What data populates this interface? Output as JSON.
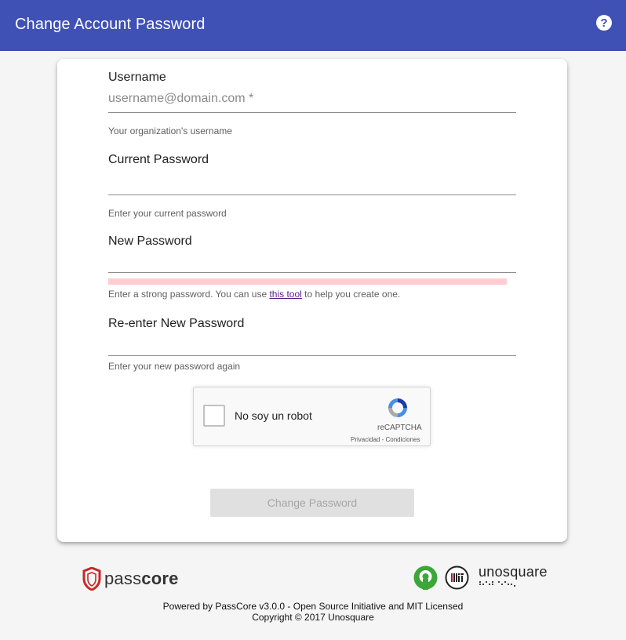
{
  "header": {
    "title": "Change Account Password",
    "help_icon": "question-circle-icon",
    "help_glyph": "?"
  },
  "form": {
    "username": {
      "label": "Username",
      "placeholder": "username@domain.com *",
      "helper": "Your organization's username"
    },
    "current_password": {
      "label": "Current Password",
      "helper": "Enter your current password"
    },
    "new_password": {
      "label": "New Password",
      "helper_before": "Enter a strong password. You can use ",
      "helper_link": "this tool",
      "helper_after": " to help you create one.",
      "strength": 0
    },
    "confirm_password": {
      "label": "Re-enter New Password",
      "helper": "Enter your new password again"
    },
    "submit_label": "Change Password"
  },
  "captcha": {
    "label": "No soy un robot",
    "brand": "reCAPTCHA",
    "links": "Privacidad - Condiciones"
  },
  "footer": {
    "passcore_light": "pass",
    "passcore_bold": "core",
    "unosquare": "unosquare",
    "powered_by": "Powered by PassCore v3.0.0 - Open Source Initiative and MIT Licensed",
    "copyright": "Copyright © 2017 Unosquare"
  },
  "colors": {
    "primary": "#3f51b5",
    "strength_weak": "#ffcdd2",
    "button_disabled": "#e0e0e0",
    "osi_green": "#3da639",
    "passcore_red": "#c62828"
  }
}
